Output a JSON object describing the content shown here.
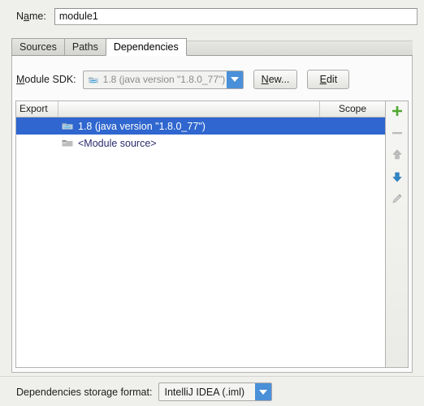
{
  "name_field": {
    "label_pre": "N",
    "label_mnemonic": "a",
    "label_post": "me:",
    "value": "module1"
  },
  "tabs": [
    {
      "label": "Sources",
      "selected": false
    },
    {
      "label": "Paths",
      "selected": false
    },
    {
      "label": "Dependencies",
      "selected": true
    }
  ],
  "sdk": {
    "label_pre": "",
    "label_mnemonic": "M",
    "label_post": "odule SDK:",
    "selected_value": "1.8 (java version \"1.8.0_77\")",
    "dropdown_icon": "chevron-down-icon",
    "sdk_icon": "java-sdk-icon",
    "new_button": {
      "mnemonic": "N",
      "rest": "ew..."
    },
    "edit_button": {
      "pre": "",
      "mnemonic": "E",
      "rest": "dit"
    }
  },
  "dependencies_table": {
    "columns": [
      "Export",
      "",
      "Scope"
    ],
    "rows": [
      {
        "export_checked": false,
        "label": "1.8 (java version \"1.8.0_77\")",
        "icon": "jdk-folder-icon",
        "scope": "",
        "selected": true
      },
      {
        "export_checked": false,
        "label": "<Module source>",
        "icon": "module-source-folder-icon",
        "scope": "",
        "selected": false
      }
    ]
  },
  "side_toolbar": [
    {
      "name": "add-button",
      "icon": "plus-icon",
      "color": "#4ea832",
      "enabled": true
    },
    {
      "name": "remove-button",
      "icon": "minus-icon",
      "color": "#b4b4b4",
      "enabled": false
    },
    {
      "name": "move-up-button",
      "icon": "arrow-up-icon",
      "color": "#b9b9b9",
      "enabled": false
    },
    {
      "name": "move-down-button",
      "icon": "arrow-down-icon",
      "color": "#2e86c8",
      "enabled": true
    },
    {
      "name": "edit-button",
      "icon": "pencil-icon",
      "color": "#b9b9b9",
      "enabled": false
    }
  ],
  "storage_format": {
    "label": "Dependencies storage format:",
    "selected_value": "IntelliJ IDEA (.iml)",
    "dropdown_icon": "chevron-down-icon"
  },
  "colors": {
    "selection_blue": "#2f66cf",
    "accent_blue": "#4a90d9",
    "link_navy": "#2b2b6e",
    "window_bg": "#efefec",
    "panel_bg": "#fbfbfb"
  }
}
